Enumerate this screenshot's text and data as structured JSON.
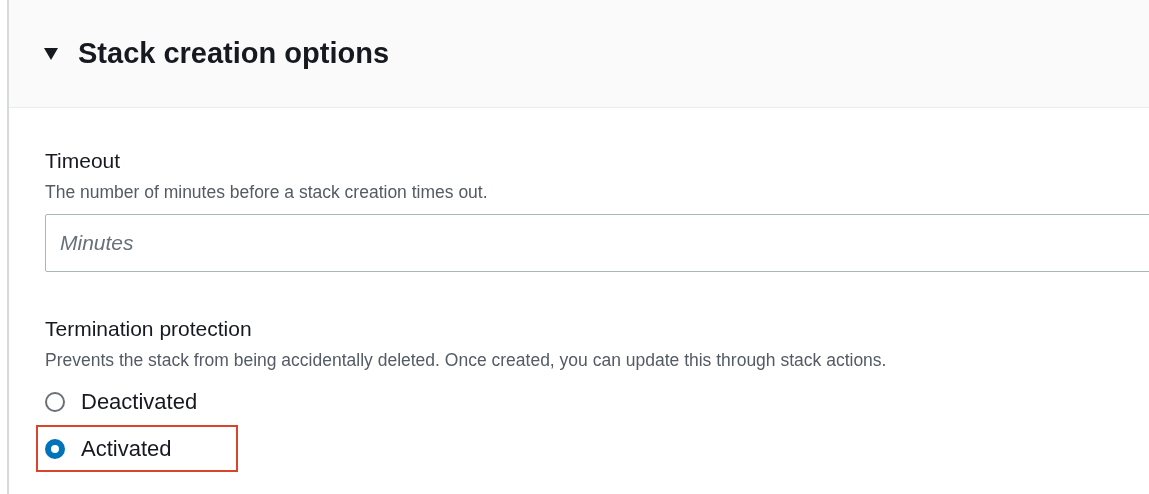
{
  "section": {
    "title": "Stack creation options",
    "expanded": true
  },
  "timeout": {
    "label": "Timeout",
    "description": "The number of minutes before a stack creation times out.",
    "placeholder": "Minutes"
  },
  "termination_protection": {
    "label": "Termination protection",
    "description": "Prevents the stack from being accidentally deleted. Once created, you can update this through stack actions.",
    "options": [
      {
        "label": "Deactivated",
        "selected": false,
        "highlighted": false
      },
      {
        "label": "Activated",
        "selected": true,
        "highlighted": true
      }
    ]
  }
}
